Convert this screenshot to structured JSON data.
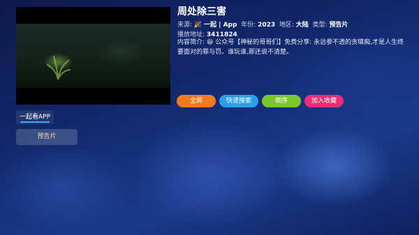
{
  "video": {
    "title": "周处除三害"
  },
  "meta": {
    "source_label": "来源:",
    "source_emoji": "🎉",
    "source_value": "一起 | App",
    "year_label": "年份:",
    "year_value": "2023",
    "region_label": "地区:",
    "region_value": "大陆",
    "type_label": "类型:",
    "type_value": "预告片",
    "address_label": "播放地址:",
    "address_value": "3411824"
  },
  "description": {
    "label": "内容简介:",
    "emoji": "😆",
    "text": "公众号【神秘的哥哥们】免费分享: 永远参不透的贪嗔痴,才是人生终要面对的罪与罚。谁玩谁,那还说不清楚。"
  },
  "actions": {
    "fullscreen": "全屏",
    "quick_search": "快速搜索",
    "reverse_order": "倒序",
    "add_favorite": "加入收藏"
  },
  "sources": {
    "active": "一起看APP"
  },
  "episodes": [
    {
      "label": "预告片"
    }
  ],
  "colors": {
    "fullscreen": "#f47a1f",
    "quick_search": "#2aa0e6",
    "reverse_order": "#7ac72b",
    "add_favorite": "#ea2d74"
  }
}
